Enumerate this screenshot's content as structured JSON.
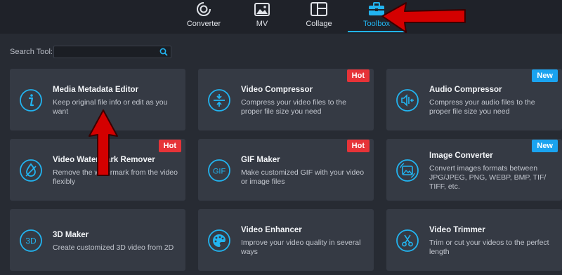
{
  "nav": {
    "tabs": [
      {
        "label": "Converter"
      },
      {
        "label": "MV"
      },
      {
        "label": "Collage"
      },
      {
        "label": "Toolbox"
      }
    ],
    "active_tab": "Toolbox"
  },
  "search": {
    "label": "Search Tool:",
    "value": ""
  },
  "tools": [
    {
      "title": "Media Metadata Editor",
      "description": "Keep original file info or edit as you want",
      "badge": "",
      "icon": "info-icon"
    },
    {
      "title": "Video Compressor",
      "description": "Compress your video files to the proper file size you need",
      "badge": "Hot",
      "icon": "compress-icon"
    },
    {
      "title": "Audio Compressor",
      "description": "Compress your audio files to the proper file size you need",
      "badge": "New",
      "icon": "audio-compress-icon"
    },
    {
      "title": "Video Watermark Remover",
      "description": "Remove the watermark from the video flexibly",
      "badge": "Hot",
      "icon": "watermark-drop-icon"
    },
    {
      "title": "GIF Maker",
      "description": "Make customized GIF with your video or image files",
      "badge": "Hot",
      "icon": "gif-icon",
      "icon_text": "GIF"
    },
    {
      "title": "Image Converter",
      "description": "Convert images formats between JPG/JPEG, PNG, WEBP, BMP, TIF/ TIFF, etc.",
      "badge": "New",
      "icon": "image-convert-icon"
    },
    {
      "title": "3D Maker",
      "description": "Create customized 3D video from 2D",
      "badge": "",
      "icon": "3d-icon",
      "icon_text": "3D"
    },
    {
      "title": "Video Enhancer",
      "description": "Improve your video quality in several ways",
      "badge": "",
      "icon": "palette-icon"
    },
    {
      "title": "Video Trimmer",
      "description": "Trim or cut your videos to the perfect length",
      "badge": "",
      "icon": "scissors-icon"
    }
  ],
  "colors": {
    "accent": "#22b4f0",
    "hot": "#e63338",
    "new": "#1aa3f0",
    "annotation": "#d40000"
  }
}
